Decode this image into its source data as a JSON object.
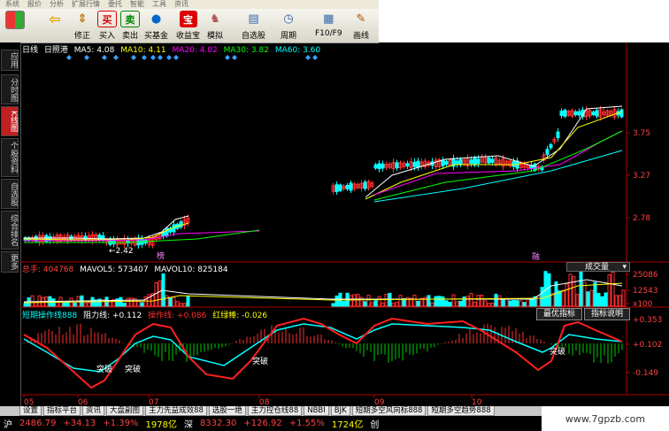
{
  "menu": {
    "items": [
      "系统",
      "报价",
      "分析",
      "扩展行情",
      "委托",
      "智能",
      "工具",
      "资讯"
    ]
  },
  "toolbar": {
    "buttons": [
      {
        "label": "",
        "icon": "color-grid-icon"
      },
      {
        "label": "",
        "icon": "back-arrow-icon"
      },
      {
        "label": "修正",
        "icon": "adjust-icon"
      },
      {
        "label": "买入",
        "icon": "buy-icon"
      },
      {
        "label": "卖出",
        "icon": "sell-icon"
      },
      {
        "label": "买基金",
        "icon": "fund-icon"
      },
      {
        "label": "收益宝",
        "icon": "treasure-icon"
      },
      {
        "label": "模拟",
        "icon": "simulate-icon"
      },
      {
        "label": "自选股",
        "icon": "watchlist-icon"
      },
      {
        "label": "周期",
        "icon": "period-icon"
      },
      {
        "label": "F10/F9",
        "icon": "f10-icon"
      },
      {
        "label": "画线",
        "icon": "draw-icon"
      }
    ]
  },
  "sidebar": {
    "tabs": [
      "应用",
      "分时图",
      "K线图",
      "个股资料",
      "自选股",
      "综合排名",
      "更多"
    ]
  },
  "main": {
    "period": "日线",
    "stock_name": "日照港",
    "ma": [
      {
        "label": "MA5: 4.08",
        "color": "#ffffff"
      },
      {
        "label": "MA10: 4.11",
        "color": "#ffff00"
      },
      {
        "label": "MA20: 4.02",
        "color": "#ff00ff"
      },
      {
        "label": "MA30: 3.82",
        "color": "#00ff00"
      },
      {
        "label": "MA60: 3.60",
        "color": "#00ffff"
      }
    ],
    "price_ticks": [
      "3.75",
      "3.27",
      "2.78"
    ],
    "low_label": "2.42",
    "event_tags": [
      "榜",
      "融"
    ]
  },
  "volume": {
    "total_label": "总手: 404768",
    "mavol5": "MAVOL5: 573407",
    "mavol10": "MAVOL10: 825184",
    "dropdown": "成交量",
    "ticks": [
      "25086",
      "12543",
      "x100"
    ]
  },
  "indicator": {
    "name": "短期操作线888",
    "resistance": "阻力线: +0.112",
    "operation": "操作线: +0.086",
    "redgreen": "红绿棒: -0.026",
    "buttons": [
      "最优指标",
      "指标说明"
    ],
    "ticks": [
      "+0.353",
      "+0.102",
      "-0.149"
    ],
    "annotations": [
      "突破",
      "突破",
      "突破",
      "突破"
    ]
  },
  "xaxis": {
    "months": [
      "05",
      "06",
      "07",
      "08",
      "09",
      "10"
    ]
  },
  "tabs": [
    "设置",
    "指标平台",
    "资讯",
    "大盘副图",
    "主力先益成效88",
    "选股一绝",
    "主力控仓线88",
    "NBBI",
    "BJK",
    "短期多空风向标888",
    "短期多空趋势888"
  ],
  "status": {
    "sh_label": "沪",
    "sh_index": "2486.79",
    "sh_change": "+34.13",
    "sh_pct": "+1.39%",
    "sh_amount": "1978亿",
    "sz_label": "深",
    "sz_index": "8332.30",
    "sz_change": "+126.92",
    "sz_pct": "+1.55%",
    "sz_amount": "1724亿",
    "sz_board": "创"
  },
  "watermark": "www.7gpzb.com",
  "colors": {
    "up": "#ff3030",
    "down": "#00ffff",
    "ma5": "#ffffff",
    "ma10": "#ffff00",
    "ma20": "#ff00ff",
    "ma30": "#00ff00",
    "ma60": "#00ffff"
  }
}
